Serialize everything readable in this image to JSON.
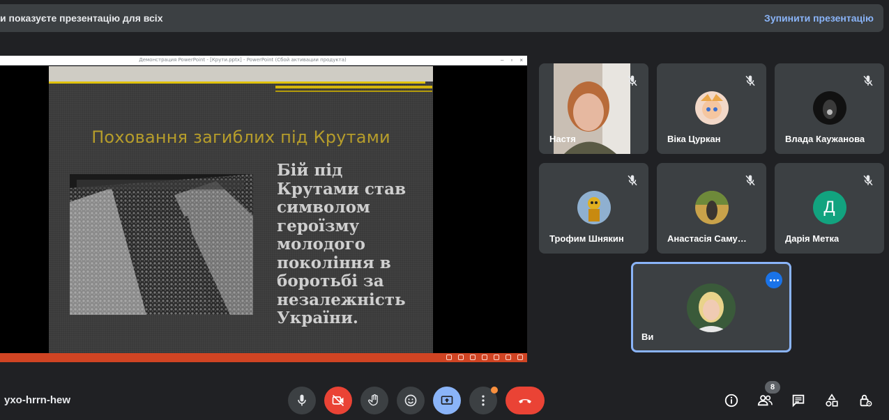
{
  "banner": {
    "text": "и показуєте презентацію для всіх",
    "stop_label": "Зупинити презентацію"
  },
  "presentation": {
    "window_title": "Демонстрация PowerPoint - [Крути.pptx] - PowerPoint (Сбой активации продукта)",
    "slide": {
      "heading": "Поховання загиблих під Крутами",
      "body_lines": [
        "Бій під",
        "Крутами став",
        "символом",
        "героїзму",
        "молодого",
        "покоління в",
        "боротьбі за",
        "незалежність",
        "України."
      ]
    }
  },
  "participants": [
    {
      "name": "Настя",
      "type": "video",
      "muted": true
    },
    {
      "name": "Віка Цуркан",
      "type": "avatar",
      "muted": true
    },
    {
      "name": "Влада Каужанова",
      "type": "avatar",
      "muted": true
    },
    {
      "name": "Трофим Шнякин",
      "type": "avatar",
      "muted": true
    },
    {
      "name": "Анастасія Саму…",
      "type": "avatar",
      "muted": true
    },
    {
      "name": "Дарія Метка",
      "type": "letter",
      "letter": "Д",
      "muted": true
    }
  ],
  "self_tile": {
    "name": "Ви"
  },
  "meeting": {
    "code": "yxo-hrrn-hew",
    "participant_count": "8"
  },
  "colors": {
    "background": "#202124",
    "tile": "#3c4043",
    "accent_blue": "#8ab4f8",
    "hangup_red": "#ea4335",
    "slide_heading_gold": "#b69d2b",
    "pp_status_bar": "#d04423",
    "letter_avatar": "#12a37f"
  },
  "icons": {
    "controls": [
      "mic-icon",
      "camera-off-icon",
      "raise-hand-icon",
      "emoji-icon",
      "present-screen-icon",
      "more-options-icon",
      "hang-up-icon"
    ],
    "right": [
      "info-icon",
      "people-icon",
      "chat-icon",
      "activities-icon",
      "host-controls-icon"
    ]
  }
}
